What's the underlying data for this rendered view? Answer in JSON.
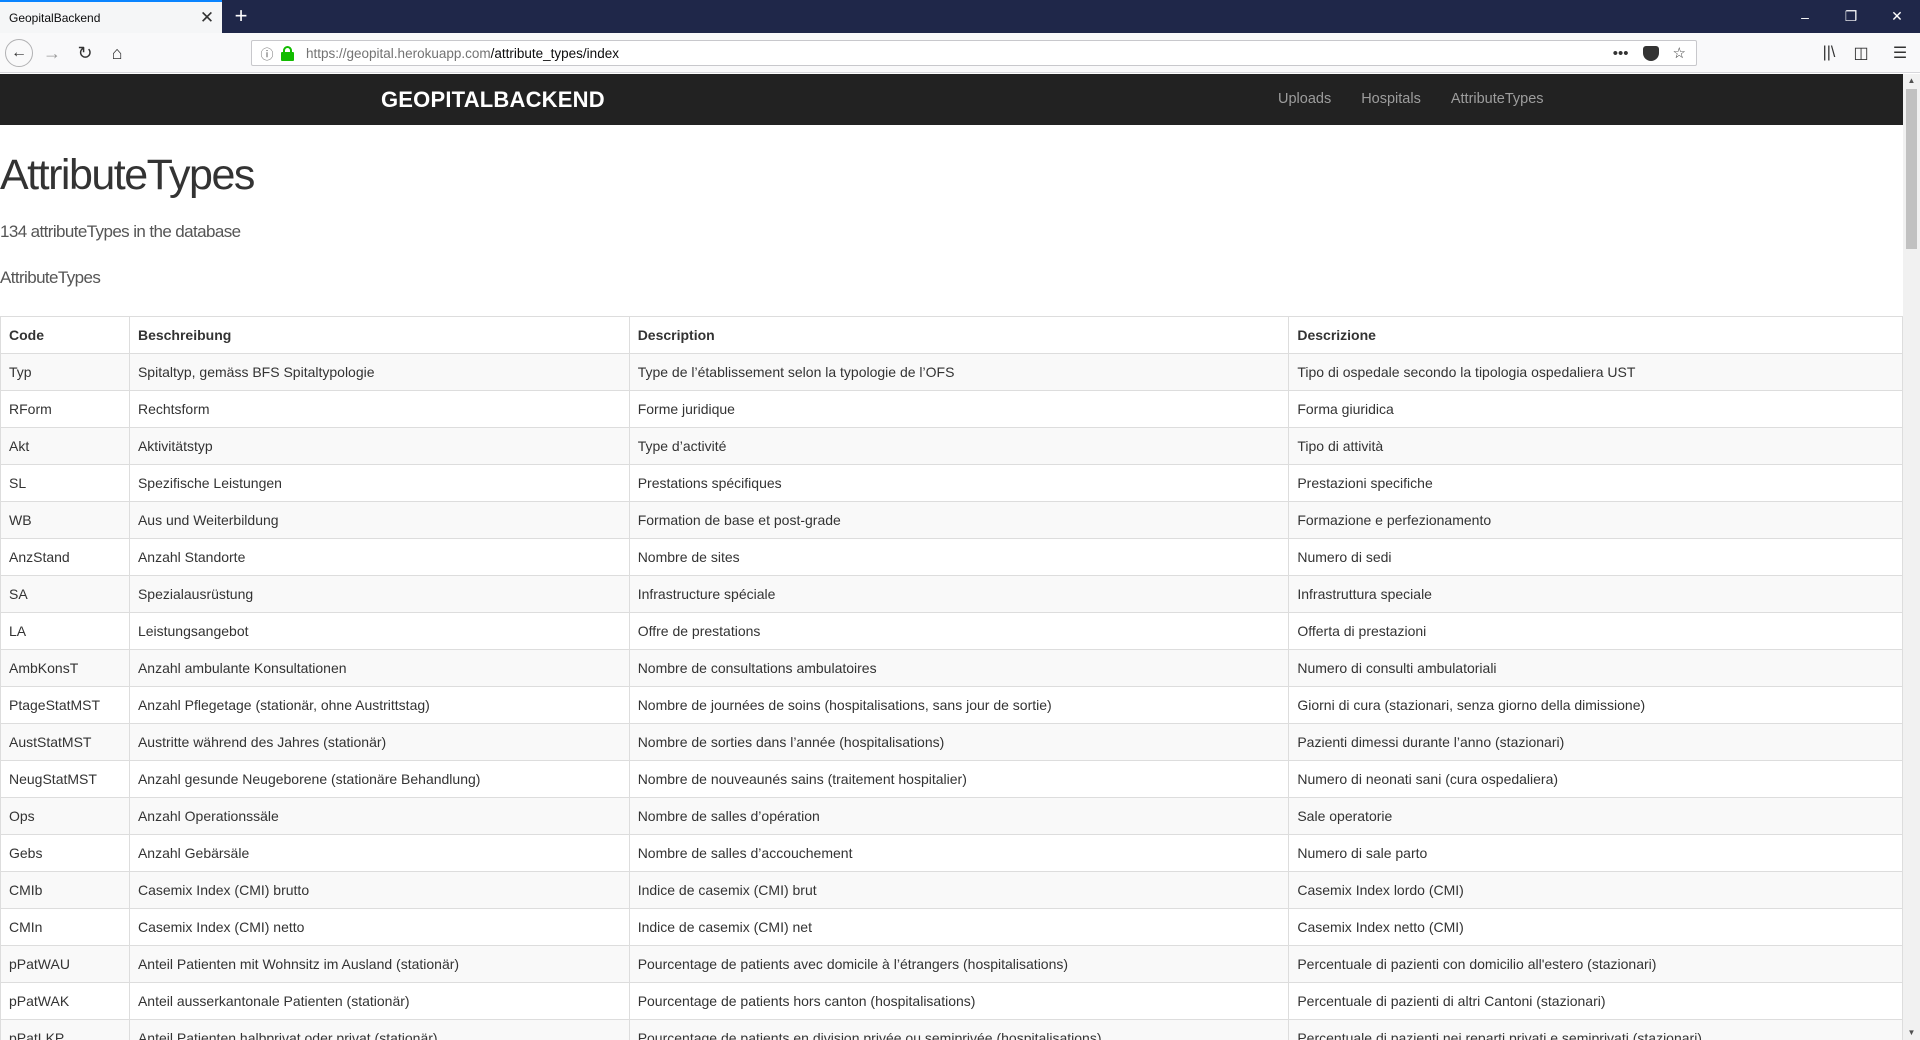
{
  "browser": {
    "tab_title": "GeopitalBackend",
    "url_host": "https://geopital.herokuapp.com",
    "url_path": "/attribute_types/index"
  },
  "site": {
    "brand": "GEOPITALBACKEND",
    "nav": [
      {
        "label": "Uploads"
      },
      {
        "label": "Hospitals"
      },
      {
        "label": "AttributeTypes"
      }
    ]
  },
  "page": {
    "title": "AttributeTypes",
    "count_text": "134 attributeTypes in the database",
    "table_caption": "AttributeTypes"
  },
  "table": {
    "headers": [
      "Code",
      "Beschreibung",
      "Description",
      "Descrizione"
    ],
    "rows": [
      [
        "Typ",
        "Spitaltyp, gemäss BFS Spitaltypologie",
        "Type de l’établissement selon la typologie de l’OFS",
        "Tipo di ospedale secondo la tipologia ospedaliera UST"
      ],
      [
        "RForm",
        "Rechtsform",
        "Forme juridique",
        "Forma giuridica"
      ],
      [
        "Akt",
        "Aktivitätstyp",
        "Type d’activité",
        "Tipo di attività"
      ],
      [
        "SL",
        "Spezifische Leistungen",
        "Prestations spécifiques",
        "Prestazioni specifiche"
      ],
      [
        "WB",
        "Aus und Weiterbildung",
        "Formation de base et post-grade",
        "Formazione e perfezionamento"
      ],
      [
        "AnzStand",
        "Anzahl Standorte",
        "Nombre de sites",
        "Numero di sedi"
      ],
      [
        "SA",
        "Spezialausrüstung",
        "Infrastructure spéciale",
        "Infrastruttura speciale"
      ],
      [
        "LA",
        "Leistungsangebot",
        "Offre de prestations",
        "Offerta di prestazioni"
      ],
      [
        "AmbKonsT",
        "Anzahl ambulante Konsultationen",
        "Nombre de consultations ambulatoires",
        "Numero di consulti ambulatoriali"
      ],
      [
        "PtageStatMST",
        "Anzahl Pflegetage (stationär, ohne Austrittstag)",
        "Nombre de journées de soins (hospitalisations, sans jour de sortie)",
        "Giorni di cura (stazionari, senza giorno della dimissione)"
      ],
      [
        "AustStatMST",
        "Austritte während des Jahres (stationär)",
        "Nombre de sorties dans l’année (hospitalisations)",
        "Pazienti dimessi durante l’anno (stazionari)"
      ],
      [
        "NeugStatMST",
        "Anzahl gesunde Neugeborene (stationäre Behandlung)",
        "Nombre de nouveaunés sains (traitement hospitalier)",
        "Numero di neonati sani (cura ospedaliera)"
      ],
      [
        "Ops",
        "Anzahl Operationssäle",
        "Nombre de salles d’opération",
        "Sale operatorie"
      ],
      [
        "Gebs",
        "Anzahl Gebärsäle",
        "Nombre de salles d’accouchement",
        "Numero di sale parto"
      ],
      [
        "CMIb",
        "Casemix Index (CMI) brutto",
        "Indice de casemix (CMI) brut",
        "Casemix Index lordo (CMI)"
      ],
      [
        "CMIn",
        "Casemix Index (CMI) netto",
        "Indice de casemix (CMI) net",
        "Casemix Index netto (CMI)"
      ],
      [
        "pPatWAU",
        "Anteil Patienten mit Wohnsitz im Ausland (stationär)",
        "Pourcentage de patients avec domicile à l’étrangers (hospitalisations)",
        "Percentuale di pazienti con domicilio all'estero (stazionari)"
      ],
      [
        "pPatWAK",
        "Anteil ausserkantonale Patienten (stationär)",
        "Pourcentage de patients hors canton (hospitalisations)",
        "Percentuale di pazienti di altri Cantoni (stazionari)"
      ],
      [
        "pPatLKP",
        "Anteil Patienten halbprivat oder privat (stationär)",
        "Pourcentage de patients en division privée ou semiprivée (hospitalisations)",
        "Percentuale di pazienti nei reparti privati e semiprivati (stazionari)"
      ]
    ]
  }
}
